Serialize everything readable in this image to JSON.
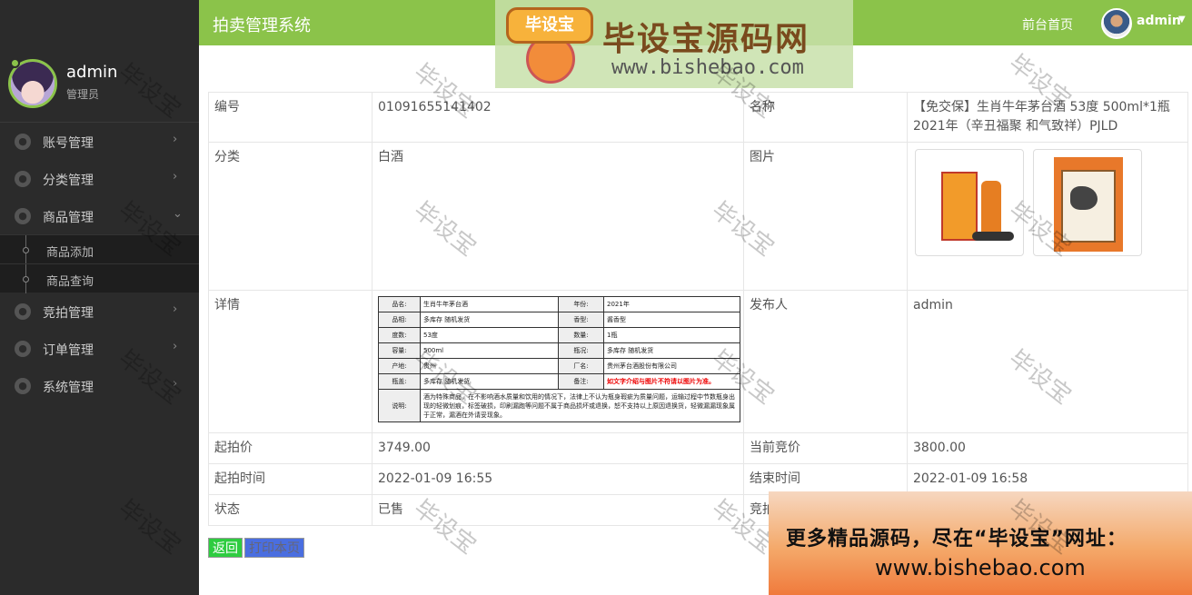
{
  "header": {
    "title": "拍卖管理系统",
    "home_link": "前台首页",
    "user": "admin"
  },
  "sidebar": {
    "profile_name": "admin",
    "profile_role": "管理员",
    "items": [
      {
        "label": "账号管理",
        "icon": "globe-icon",
        "arrow": "›"
      },
      {
        "label": "分类管理",
        "icon": "globe-icon",
        "arrow": "›"
      },
      {
        "label": "商品管理",
        "icon": "globe-icon",
        "arrow": "⌄"
      },
      {
        "label": "竞拍管理",
        "icon": "globe-icon",
        "arrow": "›"
      },
      {
        "label": "订单管理",
        "icon": "globe-icon",
        "arrow": "›"
      },
      {
        "label": "系统管理",
        "icon": "globe-icon",
        "arrow": "›"
      }
    ],
    "subitems": [
      "商品添加",
      "商品查询"
    ]
  },
  "detail": {
    "row1": {
      "k1": "编号",
      "v1": "01091655141402",
      "k2": "名称",
      "v2": "【免交保】生肖牛年茅台酒 53度 500ml*1瓶 2021年（辛丑福聚 和气致祥）PJLD"
    },
    "row2": {
      "k1": "分类",
      "v1": "白酒",
      "k2": "图片"
    },
    "row3": {
      "k1": "详情",
      "k2": "发布人",
      "v2": "admin"
    },
    "row4": {
      "k1": "起拍价",
      "v1": "3749.00",
      "k2": "当前竞价",
      "v2": "3800.00"
    },
    "row5": {
      "k1": "起拍时间",
      "v1": "2022-01-09 16:55",
      "k2": "结束时间",
      "v2": "2022-01-09 16:58"
    },
    "row6": {
      "k1": "状态",
      "v1": "已售",
      "k2": "竞拍"
    }
  },
  "spec": {
    "r1": [
      "品名:",
      "生肖牛年茅台酒",
      "年份:",
      "2021年"
    ],
    "r2": [
      "品相:",
      "多库存 随机发货",
      "香型:",
      "酱香型"
    ],
    "r3": [
      "度数:",
      "53度",
      "数量:",
      "1瓶"
    ],
    "r4": [
      "容量:",
      "500ml",
      "瓶况:",
      "多库存 随机发货"
    ],
    "r5": [
      "产地:",
      "贵州",
      "厂名:",
      "贵州茅台酒股份有限公司"
    ],
    "r6": [
      "瓶盖:",
      "多库存 随机发货",
      "备注:",
      "如文字介绍与图片不符请以图片为准。"
    ],
    "note_label": "说明:",
    "note": "酒为特殊商品，在不影响酒水质量和饮用的情况下，法律上不认为瓶身瑕疵为质量问题，运输过程中节数瓶身出现的轻微划痕，标签破损，印刷漏跑等问题不属于商品损坏或退换，恕不支持以上原因退换货，轻微漏漏现象属于正常，漏酒在外请妥现象。"
  },
  "buttons": {
    "back": "返回",
    "print": "打印本页"
  },
  "watermark": {
    "logo_badge": "毕设宝",
    "logo_title": "毕设宝源码网",
    "logo_url": "www.bishebao.com",
    "diag_text": "毕设宝",
    "promo_line1": "更多精品源码，尽在“毕设宝”网址：",
    "promo_line2": "www.bishebao.com"
  },
  "colors": {
    "header": "#8bc34a",
    "sidebar": "#2b2b2b",
    "back_button": "#2ecc40",
    "print_button": "#4a6ee0"
  }
}
